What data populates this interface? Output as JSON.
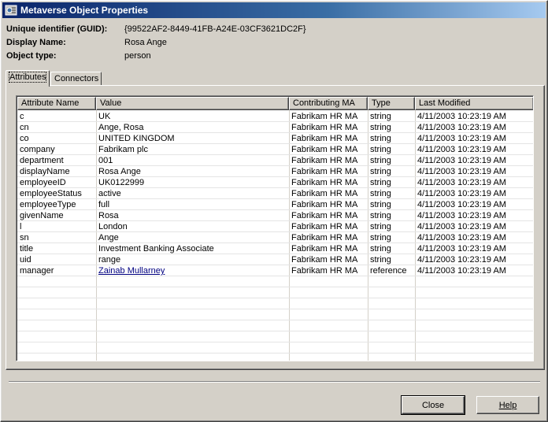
{
  "window": {
    "title": "Metaverse Object Properties"
  },
  "object": {
    "guid_label": "Unique identifier (GUID):",
    "guid_value": "{99522AF2-8449-41FB-A24E-03CF3621DC2F}",
    "display_label": "Display Name:",
    "display_value": "Rosa Ange",
    "type_label": "Object type:",
    "type_value": "person"
  },
  "tabs": [
    {
      "label": "Attributes",
      "active": true
    },
    {
      "label": "Connectors",
      "active": false
    }
  ],
  "table": {
    "columns": [
      "Attribute Name",
      "Value",
      "Contributing MA",
      "Type",
      "Last Modified"
    ],
    "rows": [
      [
        "c",
        "UK",
        "Fabrikam HR MA",
        "string",
        "4/11/2003 10:23:19 AM"
      ],
      [
        "cn",
        "Ange, Rosa",
        "Fabrikam HR MA",
        "string",
        "4/11/2003 10:23:19 AM"
      ],
      [
        "co",
        "UNITED KINGDOM",
        "Fabrikam HR MA",
        "string",
        "4/11/2003 10:23:19 AM"
      ],
      [
        "company",
        "Fabrikam plc",
        "Fabrikam HR MA",
        "string",
        "4/11/2003 10:23:19 AM"
      ],
      [
        "department",
        "001",
        "Fabrikam HR MA",
        "string",
        "4/11/2003 10:23:19 AM"
      ],
      [
        "displayName",
        "Rosa Ange",
        "Fabrikam HR MA",
        "string",
        "4/11/2003 10:23:19 AM"
      ],
      [
        "employeeID",
        "UK0122999",
        "Fabrikam HR MA",
        "string",
        "4/11/2003 10:23:19 AM"
      ],
      [
        "employeeStatus",
        "active",
        "Fabrikam HR MA",
        "string",
        "4/11/2003 10:23:19 AM"
      ],
      [
        "employeeType",
        "full",
        "Fabrikam HR MA",
        "string",
        "4/11/2003 10:23:19 AM"
      ],
      [
        "givenName",
        "Rosa",
        "Fabrikam HR MA",
        "string",
        "4/11/2003 10:23:19 AM"
      ],
      [
        "l",
        "London",
        "Fabrikam HR MA",
        "string",
        "4/11/2003 10:23:19 AM"
      ],
      [
        "sn",
        "Ange",
        "Fabrikam HR MA",
        "string",
        "4/11/2003 10:23:19 AM"
      ],
      [
        "title",
        "Investment Banking Associate",
        "Fabrikam HR MA",
        "string",
        "4/11/2003 10:23:19 AM"
      ],
      [
        "uid",
        "range",
        "Fabrikam HR MA",
        "string",
        "4/11/2003 10:23:19 AM"
      ],
      [
        "manager",
        "Zainab Mullarney",
        "Fabrikam HR MA",
        "reference",
        "4/11/2003 10:23:19 AM"
      ]
    ],
    "link_rows": [
      14
    ]
  },
  "buttons": {
    "close_label": "Close",
    "help_label": "Help"
  },
  "colors": {
    "title_bar_start": "#0a246a",
    "title_bar_end": "#a6caf0",
    "dialog_face": "#d4d0c8",
    "link": "#000080"
  }
}
